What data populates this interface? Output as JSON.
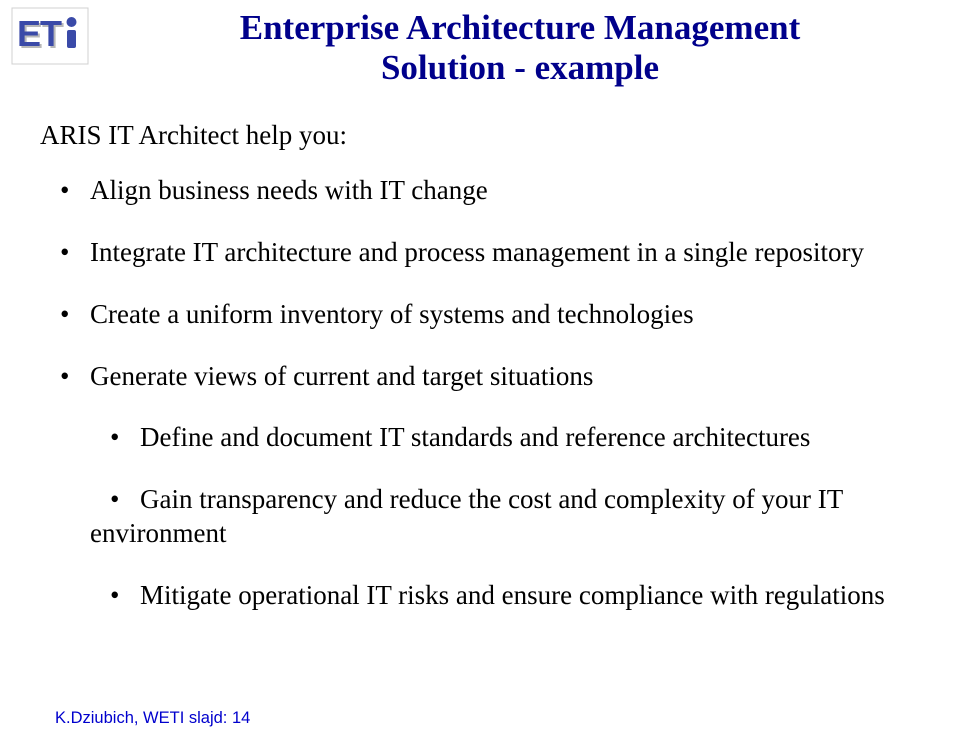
{
  "logo": {
    "letters": "ETi",
    "colors": {
      "e": "#3a4aa8",
      "t": "#3a4aa8",
      "i": "#3a4aa8",
      "shadow": "#b0b0b0"
    }
  },
  "heading": {
    "line1": "Enterprise Architecture Management",
    "line2": "Solution - example"
  },
  "lead": "ARIS IT Architect help you:",
  "bullets": [
    "Align business needs with IT change",
    "Integrate IT architecture and process management in a single repository",
    "Create a uniform inventory of systems and technologies",
    "Generate views of current and target situations"
  ],
  "nested_bullets": [
    "Define and document IT standards and reference architectures",
    "Gain transparency and reduce the cost and complexity of your IT environment",
    "Mitigate operational IT risks and ensure compliance with regulations"
  ],
  "footer": "K.Dziubich, WETI slajd: 14"
}
